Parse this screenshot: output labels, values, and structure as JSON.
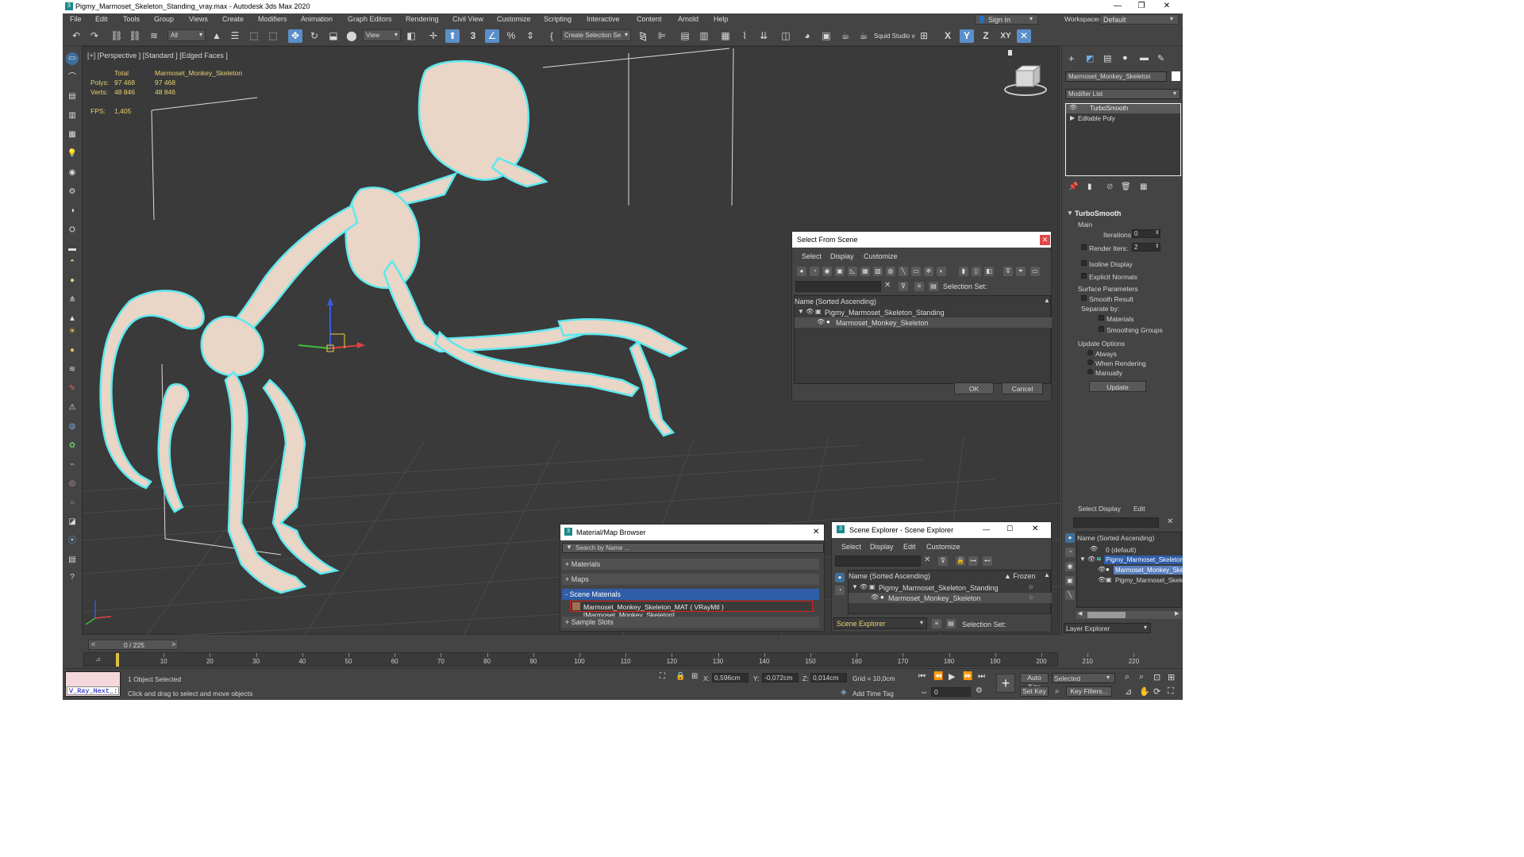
{
  "window": {
    "title": "Pigmy_Marmoset_Skeleton_Standing_vray.max - Autodesk 3ds Max 2020",
    "minimize": "—",
    "maximize": "❐",
    "close": "✕"
  },
  "menu": [
    "File",
    "Edit",
    "Tools",
    "Group",
    "Views",
    "Create",
    "Modifiers",
    "Animation",
    "Graph Editors",
    "Rendering",
    "Civil View",
    "Customize",
    "Scripting",
    "Interactive",
    "Content",
    "Arnold",
    "Help"
  ],
  "account": {
    "sign_in": "Sign In",
    "workspaces_label": "Workspaces:",
    "workspace_value": "Default"
  },
  "toolbar": {
    "filter_value": "All",
    "refcoord_value": "View",
    "snap_3": "3",
    "selection_set": "Create Selection Se",
    "squid": "Squid Studio v",
    "axis_x": "X",
    "axis_y": "Y",
    "axis_z": "Z",
    "axis_xy": "XY"
  },
  "viewport": {
    "label": "[+] [Perspective ] [Standard ] [Edged Faces ]",
    "stats_total": "Total",
    "stats_object": "Marmoset_Monkey_Skeleton",
    "polys_label": "Polys:",
    "polys_total": "97 468",
    "polys_object": "97 468",
    "verts_label": "Verts:",
    "verts_total": "48 846",
    "verts_object": "48 846",
    "fps_label": "FPS:",
    "fps_value": "1,405"
  },
  "select_from_scene": {
    "title": "Select From Scene",
    "tabs": [
      "Select",
      "Display",
      "Customize"
    ],
    "selection_set_label": "Selection Set:",
    "column": "Name (Sorted Ascending)",
    "rows": [
      "Pigmy_Marmoset_Skeleton_Standing",
      "Marmoset_Monkey_Skeleton"
    ],
    "ok": "OK",
    "cancel": "Cancel"
  },
  "material_browser": {
    "title": "Material/Map Browser",
    "search_placeholder": "Search by Name ...",
    "groups": [
      "+ Materials",
      "+ Maps",
      "- Scene Materials",
      "+ Sample Slots"
    ],
    "material_item": "Marmoset_Monkey_Skeleton_MAT ( VRayMtl ) [Marmoset_Monkey_Skeleton]"
  },
  "scene_explorer": {
    "title": "Scene Explorer - Scene Explorer",
    "tabs": [
      "Select",
      "Display",
      "Edit",
      "Customize"
    ],
    "column": "Name (Sorted Ascending)",
    "frozen": "▲ Frozen",
    "rows": [
      "Pigmy_Marmoset_Skeleton_Standing",
      "Marmoset_Monkey_Skeleton"
    ],
    "explorer_value": "Scene Explorer",
    "selection_set_label": "Selection Set:"
  },
  "command_panel": {
    "object_name": "Marmoset_Monkey_Skeleton",
    "modifier_list": "Modifier List",
    "stack": [
      "TurboSmooth",
      "Editable Poly"
    ],
    "rollout_title": "TurboSmooth",
    "main_label": "Main",
    "iterations_label": "Iterations:",
    "iterations_value": "0",
    "render_iters_label": "Render Iters:",
    "render_iters_value": "2",
    "isoline": "Isoline Display",
    "explicit_normals": "Explicit Normals",
    "surface_params": "Surface Parameters",
    "smooth_result": "Smooth Result",
    "separate_by": "Separate by:",
    "materials": "Materials",
    "smoothing_groups": "Smoothing Groups",
    "update_options": "Update Options",
    "always": "Always",
    "when_rendering": "When Rendering",
    "manually": "Manually",
    "update_button": "Update"
  },
  "layer_panel": {
    "tabs": [
      "Select",
      "Display",
      "Edit"
    ],
    "column": "Name (Sorted Ascending)",
    "rows": [
      "0 (default)",
      "Pigmy_Marmoset_Skeleton_",
      "Marmoset_Monkey_Ske",
      "Pigmy_Marmoset_Skele"
    ],
    "layer_explorer": "Layer Explorer"
  },
  "timeline": {
    "frame_counter": "0 / 225",
    "ticks": [
      "10",
      "20",
      "30",
      "40",
      "50",
      "60",
      "70",
      "80",
      "90",
      "100",
      "110",
      "120",
      "130",
      "140",
      "150",
      "160",
      "170",
      "180",
      "190",
      "200",
      "210",
      "220"
    ],
    "nav_prev": "<",
    "nav_next": ">"
  },
  "status": {
    "script_box": "V_Ray_Next_:",
    "selected": "1 Object Selected",
    "hint": "Click and drag to select and move objects",
    "x_label": "X:",
    "x_value": "0,596cm",
    "y_label": "Y:",
    "y_value": "-0,072cm",
    "z_label": "Z:",
    "z_value": "0,014cm",
    "grid": "Grid = 10,0cm",
    "add_time_tag": "Add Time Tag",
    "auto_key": "Auto Key",
    "set_key": "Set Key",
    "selected_dropdown": "Selected",
    "key_filters": "Key Filters...",
    "frame_value": "0"
  }
}
